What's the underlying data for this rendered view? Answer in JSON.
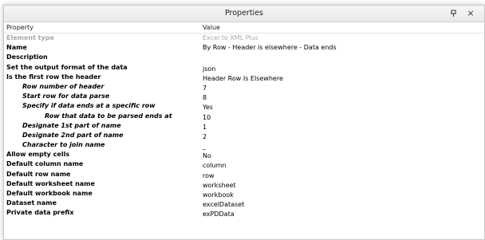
{
  "window": {
    "title": "Properties",
    "pin_icon": "pin-icon",
    "close_glyph": "×"
  },
  "grid": {
    "header": {
      "property": "Property",
      "value": "Value"
    },
    "rows": [
      {
        "property": "Element type",
        "value": "Excel to XML Plus",
        "level": 0,
        "disabled": true
      },
      {
        "property": "Name",
        "value": "By Row - Header is elsewhere - Data ends",
        "level": 0
      },
      {
        "property": "Description",
        "value": "",
        "level": 0
      },
      {
        "property": "Set the output format of the data",
        "value": "json",
        "level": 0
      },
      {
        "property": "Is the first row the header",
        "value": "Header Row Is Elsewhere",
        "level": 0
      },
      {
        "property": "Row number of header",
        "value": "7",
        "level": 1
      },
      {
        "property": "Start row for data parse",
        "value": "8",
        "level": 1
      },
      {
        "property": "Specify if data ends at a specific row",
        "value": "Yes",
        "level": 1
      },
      {
        "property": "Row that data to be parsed ends at",
        "value": "10",
        "level": 2
      },
      {
        "property": "Designate 1st part of name",
        "value": "1",
        "level": 1
      },
      {
        "property": "Designate 2nd part of name",
        "value": "2",
        "level": 1
      },
      {
        "property": "Character to join name",
        "value": "_",
        "level": 1
      },
      {
        "property": "Allow empty cells",
        "value": "No",
        "level": 0
      },
      {
        "property": "Default column name",
        "value": "column",
        "level": 0
      },
      {
        "property": "Default row name",
        "value": "row",
        "level": 0
      },
      {
        "property": "Default worksheet name",
        "value": "worksheet",
        "level": 0
      },
      {
        "property": "Default workbook name",
        "value": "workbook",
        "level": 0
      },
      {
        "property": "Dataset name",
        "value": "excelDataset",
        "level": 0
      },
      {
        "property": "Private data prefix",
        "value": "exPDData",
        "level": 0
      }
    ]
  }
}
